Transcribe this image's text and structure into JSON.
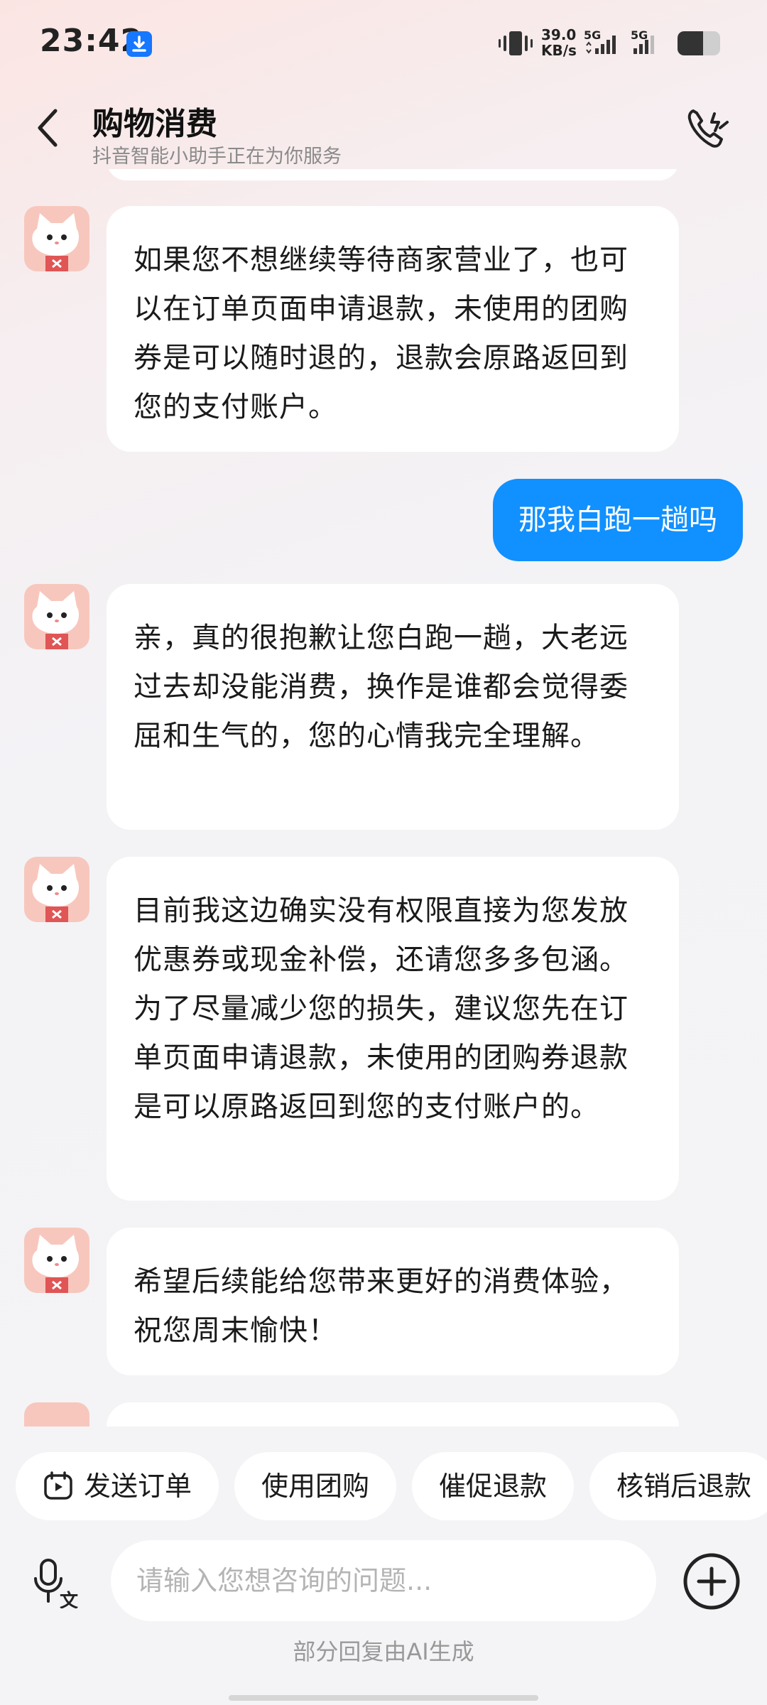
{
  "status_bar": {
    "time": "23:42",
    "net_speed_value": "39.0",
    "net_speed_unit": "KB/s",
    "signal1_label": "5G",
    "signal2_label": "5G",
    "download_icon": "download-icon",
    "battery_level": 0.6
  },
  "header": {
    "title": "购物消费",
    "subtitle": "抖音智能小助手正在为你服务",
    "back_icon": "chevron-left-icon",
    "call_icon": "phone-call-icon"
  },
  "messages": [
    {
      "sender": "assistant",
      "text": "如果您不想继续等待商家营业了，也可以在订单页面申请退款，未使用的团购券是可以随时退的，退款会原路返回到您的支付账户。"
    },
    {
      "sender": "user",
      "text": "那我白跑一趟吗"
    },
    {
      "sender": "assistant",
      "text": "亲，真的很抱歉让您白跑一趟，大老远过去却没能消费，换作是谁都会觉得委屈和生气的，您的心情我完全理解。"
    },
    {
      "sender": "assistant",
      "text": "目前我这边确实没有权限直接为您发放优惠券或现金补偿，还请您多多包涵。为了尽量减少您的损失，建议您先在订单页面申请退款，未使用的团购券退款是可以原路返回到您的支付账户的。"
    },
    {
      "sender": "assistant",
      "text": "希望后续能给您带来更好的消费体验，祝您周末愉快！"
    }
  ],
  "quick_actions": [
    {
      "label": "发送订单",
      "icon": "order-icon"
    },
    {
      "label": "使用团购"
    },
    {
      "label": "催促退款"
    },
    {
      "label": "核销后退款"
    }
  ],
  "input": {
    "placeholder": "请输入您想咨询的问题...",
    "mic_icon": "voice-to-text-icon",
    "plus_icon": "plus-circle-icon"
  },
  "disclaimer": "部分回复由AI生成",
  "colors": {
    "accent": "#1190ff",
    "avatar_bg": "#f7c7bd",
    "bubble_bg": "#ffffff"
  }
}
